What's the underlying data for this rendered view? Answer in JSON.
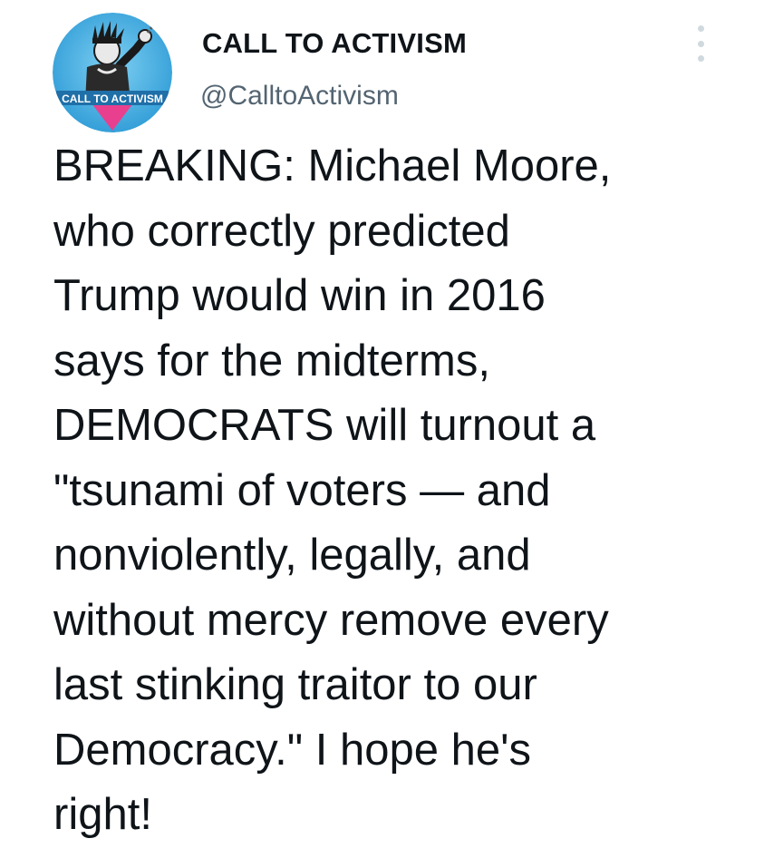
{
  "tweet": {
    "display_name": "CALL TO ACTIVISM",
    "handle": "@CalltoActivism",
    "avatar_banner_text": "CALL TO ACTIVISM",
    "text": "BREAKING: Michael Moore,\nwho correctly predicted\nTrump would win in 2016\nsays for the midterms,\nDEMOCRATS will turnout a\n\"tsunami of voters — and\nnonviolently, legally, and\nwithout mercy remove every\nlast stinking traitor to our\nDemocracy.\" I hope he's\nright!",
    "more_icon": "more-vertical-icon"
  },
  "colors": {
    "text_primary": "#0f1419",
    "text_secondary": "#536471",
    "avatar_background": "#3aa8e0",
    "avatar_banner": "#e8408e",
    "more_dots": "#cfd9de"
  }
}
